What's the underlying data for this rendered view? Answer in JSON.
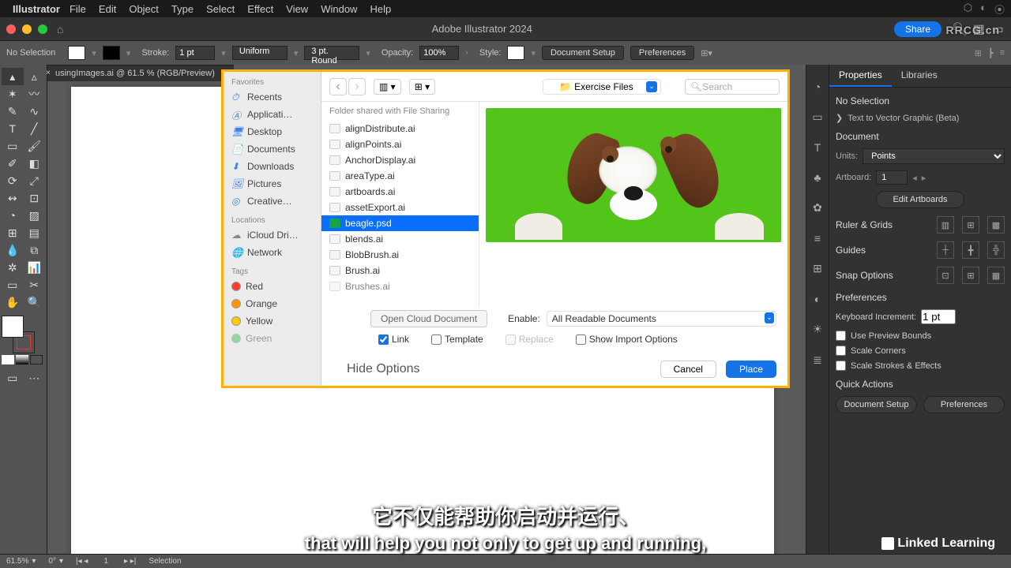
{
  "menubar": {
    "app": "Illustrator",
    "items": [
      "File",
      "Edit",
      "Object",
      "Type",
      "Select",
      "Effect",
      "View",
      "Window",
      "Help"
    ]
  },
  "topbar": {
    "title": "Adobe Illustrator 2024",
    "share": "Share"
  },
  "control": {
    "selection": "No Selection",
    "stroke_label": "Stroke:",
    "stroke_val": "1 pt",
    "profile": "Uniform",
    "brush": "3 pt. Round",
    "opacity_label": "Opacity:",
    "opacity_val": "100%",
    "style_label": "Style:",
    "doc_setup": "Document Setup",
    "prefs": "Preferences"
  },
  "tab": {
    "name": "usingImages.ai @ 61.5 % (RGB/Preview)"
  },
  "dialog": {
    "sidebar": {
      "favorites_h": "Favorites",
      "favorites": [
        "Recents",
        "Applicati…",
        "Desktop",
        "Documents",
        "Downloads",
        "Pictures",
        "Creative…"
      ],
      "locations_h": "Locations",
      "locations": [
        "iCloud Dri…",
        "Network"
      ],
      "tags_h": "Tags",
      "tags": [
        {
          "name": "Red",
          "color": "#ff3b30"
        },
        {
          "name": "Orange",
          "color": "#ff9500"
        },
        {
          "name": "Yellow",
          "color": "#ffcc00"
        },
        {
          "name": "Green",
          "color": "#34c759"
        }
      ]
    },
    "location": "Exercise Files",
    "search_ph": "Search",
    "share_h": "Folder shared with File Sharing",
    "files": [
      "alignDistribute.ai",
      "alignPoints.ai",
      "AnchorDisplay.ai",
      "areaType.ai",
      "artboards.ai",
      "assetExport.ai",
      "beagle.psd",
      "blends.ai",
      "BlobBrush.ai",
      "Brush.ai",
      "Brushes.ai"
    ],
    "selected_index": 6,
    "open_cloud": "Open Cloud Document",
    "enable_label": "Enable:",
    "enable_val": "All Readable Documents",
    "link": "Link",
    "template": "Template",
    "replace": "Replace",
    "show_import": "Show Import Options",
    "hide_opts": "Hide Options",
    "cancel": "Cancel",
    "place": "Place"
  },
  "props": {
    "tab1": "Properties",
    "tab2": "Libraries",
    "nosel": "No Selection",
    "ttvg": "Text to Vector Graphic (Beta)",
    "document_h": "Document",
    "units_label": "Units:",
    "units_val": "Points",
    "artboard_label": "Artboard:",
    "artboard_val": "1",
    "edit_ab": "Edit Artboards",
    "ruler_h": "Ruler & Grids",
    "guides_h": "Guides",
    "snap_h": "Snap Options",
    "prefs_h": "Preferences",
    "kbd_label": "Keyboard Increment:",
    "kbd_val": "1 pt",
    "cb1": "Use Preview Bounds",
    "cb2": "Scale Corners",
    "cb3": "Scale Strokes & Effects",
    "qa_h": "Quick Actions",
    "qa_ds": "Document Setup",
    "qa_pref": "Preferences"
  },
  "status": {
    "zoom": "61.5%",
    "rotate": "0°",
    "artboard": "1",
    "tool": "Selection"
  },
  "subs": {
    "zh": "它不仅能帮助你启动并运行、",
    "en": "that will help you not only to get up and running,",
    "lil": "Linked  Learning"
  },
  "wm": "RRCG.cn"
}
